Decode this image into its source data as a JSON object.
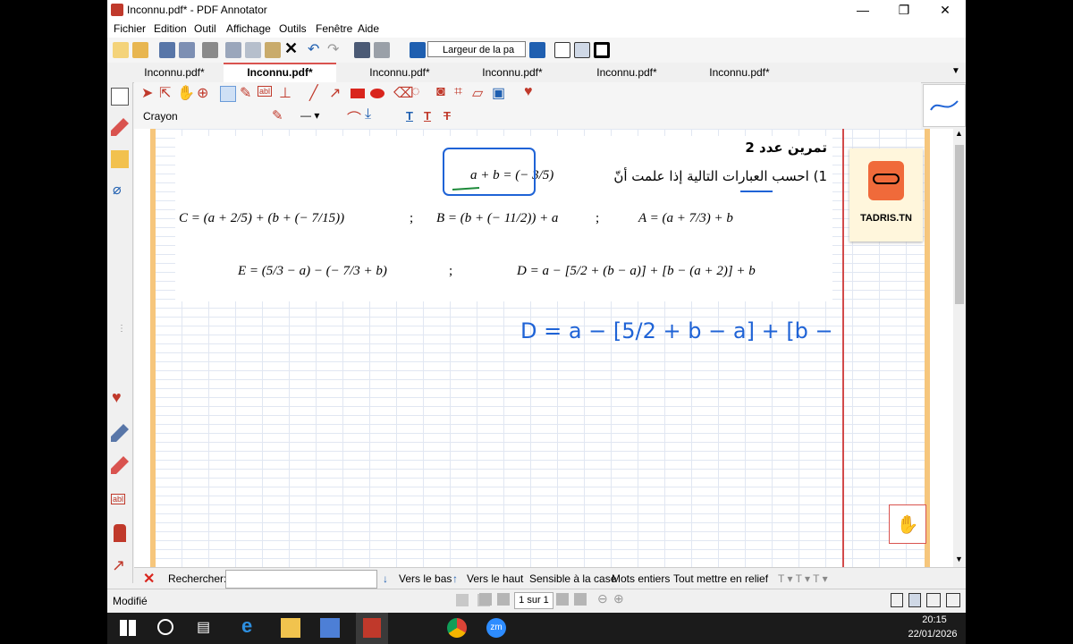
{
  "window": {
    "title": "Inconnu.pdf* - PDF Annotator",
    "minimize": "—",
    "restore": "❐",
    "close": "✕"
  },
  "menu": [
    "Fichier",
    "Edition",
    "Outil",
    "Affichage",
    "Outils",
    "Fenêtre",
    "Aide"
  ],
  "toolbar": {
    "zoom_value": "Largeur de la pa"
  },
  "tabs": [
    {
      "label": "Inconnu.pdf*",
      "active": false
    },
    {
      "label": "Inconnu.pdf*",
      "active": true
    },
    {
      "label": "Inconnu.pdf*",
      "active": false
    },
    {
      "label": "Inconnu.pdf*",
      "active": false
    },
    {
      "label": "Inconnu.pdf*",
      "active": false
    },
    {
      "label": "Inconnu.pdf*",
      "active": false
    }
  ],
  "annotation": {
    "tool_name": "Crayon",
    "text_tools": [
      "T",
      "T",
      "T"
    ]
  },
  "document": {
    "exercise_title": "تمرين عدد 2",
    "question": "1) احسب العبارات التالية إذا علمت أنّ",
    "given": "a + b = (− 3/5)",
    "expr_A": "A = (a + 7/3) + b",
    "expr_B": "B = (b + (− 11/2)) + a",
    "expr_C": "C = (a + 2/5) + (b + (− 7/15))",
    "expr_D": "D = a − [5/2 + (b − a)] + [b − (a + 2)] + b",
    "expr_E": "E = (5/3 − a) − (− 7/3 + b)",
    "separator": ";",
    "logo_text": "TADRIS.TN",
    "handwriting": "D = a − [5/2 + b − a] + [b −"
  },
  "search": {
    "label": "Rechercher:",
    "value": "",
    "down": "Vers le bas",
    "up": "Vers le haut",
    "case": "Sensible à la case",
    "whole": "Mots entiers",
    "highlight": "Tout mettre en relief"
  },
  "status": {
    "text": "Modifié",
    "page": "1 sur 1"
  },
  "taskbar": {
    "time": "20:15",
    "date": "22/01/2026"
  },
  "colors": {
    "accent_red": "#d24a4a",
    "ink_blue": "#1f63d6",
    "page_border": "#f6c67c"
  }
}
